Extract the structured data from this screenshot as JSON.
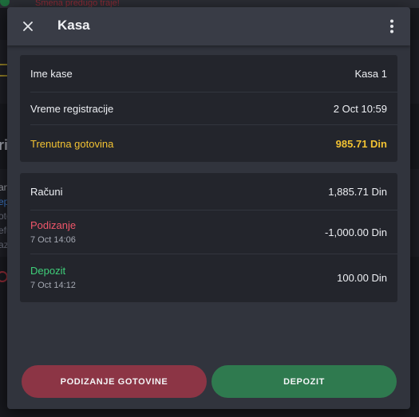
{
  "background": {
    "warning_text": "Smena predugo traje!",
    "fragment_ri": "ri",
    "fragment_an": "an",
    "fragment_ep": "ep",
    "fragment_oto": "oto",
    "fragment_efu": "efu",
    "fragment_azo": "azo"
  },
  "modal": {
    "title": "Kasa",
    "close_icon": "close-icon",
    "menu_icon": "more-vert-icon",
    "info": {
      "name_label": "Ime kase",
      "name_value": "Kasa 1",
      "reg_label": "Vreme registracije",
      "reg_value": "2 Oct 10:59",
      "cash_label": "Trenutna gotovina",
      "cash_value": "985.71 Din"
    },
    "transactions": {
      "bills_label": "Računi",
      "bills_value": "1,885.71 Din",
      "withdraw_label": "Podizanje",
      "withdraw_date": "7 Oct 14:06",
      "withdraw_value": "-1,000.00 Din",
      "deposit_label": "Depozit",
      "deposit_date": "7 Oct 14:12",
      "deposit_value": "100.00 Din"
    },
    "buttons": {
      "withdraw_label": "PODIZANJE GOTOVINE",
      "deposit_label": "DEPOZIT"
    },
    "colors": {
      "accent_gold": "#f2c233",
      "withdraw_red": "#f0566a",
      "deposit_green": "#3fd07a",
      "withdraw_button": "#8c3545",
      "deposit_button": "#2f7a4f"
    }
  }
}
